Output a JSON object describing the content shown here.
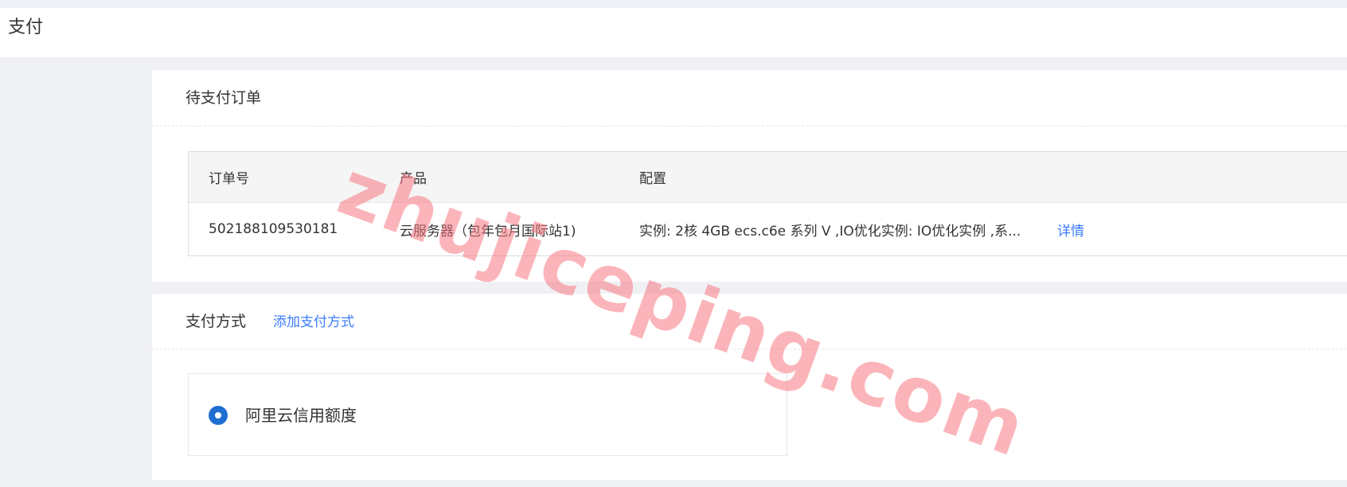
{
  "header": {
    "title": "支付"
  },
  "orders_card": {
    "title": "待支付订单",
    "columns": [
      "订单号",
      "产品",
      "配置"
    ],
    "rows": [
      {
        "order_id": "502188109530181",
        "product": "云服务器（包年包月国际站1)",
        "config": "实例: 2核 4GB ecs.c6e 系列 V ,IO优化实例: IO优化实例 ,系...",
        "action": "详情"
      }
    ]
  },
  "payment_card": {
    "title": "支付方式",
    "add_link": "添加支付方式",
    "methods": [
      {
        "label": "阿里云信用额度",
        "selected": true
      }
    ]
  },
  "watermark": {
    "text": "zhujiceping.com"
  },
  "colors": {
    "page_bg": "#f0f1f5",
    "card_bg": "#ffffff",
    "link": "#3b7cff",
    "radio": "#1f6fd1",
    "watermark": "#f77882"
  }
}
